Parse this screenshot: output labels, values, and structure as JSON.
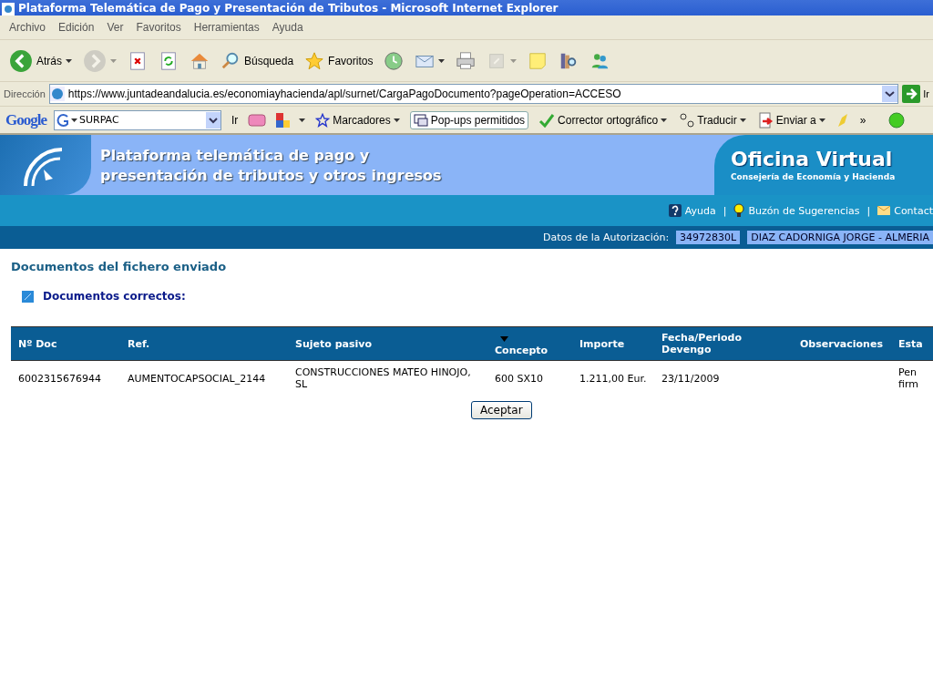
{
  "window": {
    "title": "Plataforma Telemática de Pago y Presentación de Tributos - Microsoft Internet Explorer"
  },
  "menu": [
    "Archivo",
    "Edición",
    "Ver",
    "Favoritos",
    "Herramientas",
    "Ayuda"
  ],
  "toolbar": [
    {
      "kind": "back",
      "label": "Atrás",
      "dropdown": true,
      "disabled": false
    },
    {
      "kind": "forward",
      "dropdown": true,
      "disabled": true
    },
    {
      "kind": "stop",
      "dropdown": false,
      "disabled": false
    },
    {
      "kind": "refresh",
      "dropdown": false,
      "disabled": false
    },
    {
      "kind": "home",
      "dropdown": false,
      "disabled": false
    },
    {
      "kind": "search",
      "label": "Búsqueda",
      "dropdown": false,
      "disabled": false
    },
    {
      "kind": "favorites",
      "label": "Favoritos",
      "dropdown": false,
      "disabled": false
    },
    {
      "kind": "history",
      "dropdown": false,
      "disabled": false
    },
    {
      "kind": "mail",
      "dropdown": true,
      "disabled": false
    },
    {
      "kind": "print",
      "dropdown": false,
      "disabled": false
    },
    {
      "kind": "edit",
      "dropdown": true,
      "disabled": true
    },
    {
      "kind": "notes",
      "dropdown": false,
      "disabled": false
    },
    {
      "kind": "research",
      "dropdown": false,
      "disabled": false
    },
    {
      "kind": "messenger",
      "dropdown": false,
      "disabled": false
    }
  ],
  "address": {
    "label": "Dirección",
    "url": "https://www.juntadeandalucia.es/economiayhacienda/apl/surnet/CargaPagoDocumento?pageOperation=ACCESO",
    "go": "Ir"
  },
  "google_bar": {
    "logo": "Google",
    "query": "SURPAC",
    "go": "Ir",
    "bookmarks": "Marcadores",
    "popups": "Pop-ups permitidos",
    "spelling": "Corrector ortográfico",
    "translate": "Traducir",
    "send": "Enviar a",
    "more": "»"
  },
  "banner": {
    "title_lines": [
      "Plataforma telemática de pago y",
      "presentación de tributos y otros ingresos"
    ],
    "brand": "Oficina Virtual",
    "subtitle": "Consejería de Economía y Hacienda"
  },
  "link_separator": "|",
  "links": [
    {
      "kind": "help",
      "label": "Ayuda"
    },
    {
      "kind": "suggestions",
      "label": "Buzón de Sugerencias"
    },
    {
      "kind": "contact",
      "label": "Contact"
    }
  ],
  "authorization": {
    "label": "Datos de la Autorización:",
    "nif": "34972830L",
    "name": "DIAZ CADORNIGA JORGE - ALMERIA"
  },
  "page_heading": "Documentos del fichero enviado",
  "section_heading": "Documentos correctos:",
  "table": {
    "columns": [
      {
        "label": "Nº Doc",
        "sorted": false
      },
      {
        "label": "Ref.",
        "sorted": false
      },
      {
        "label": "Sujeto pasivo",
        "sorted": false
      },
      {
        "label": "Concepto",
        "sorted": true
      },
      {
        "label": "Importe",
        "sorted": false
      },
      {
        "label": "Fecha/Periodo Devengo",
        "sorted": false
      },
      {
        "label": "Observaciones",
        "sorted": false
      },
      {
        "label": "Esta",
        "sorted": false
      }
    ],
    "rows": [
      [
        "6002315676944",
        "AUMENTOCAPSOCIAL_2144",
        "CONSTRUCCIONES MATEO HINOJO, SL",
        "600 SX10",
        "1.211,00 Eur.",
        "23/11/2009",
        "",
        "Pen firm"
      ]
    ]
  },
  "button": "Aceptar"
}
